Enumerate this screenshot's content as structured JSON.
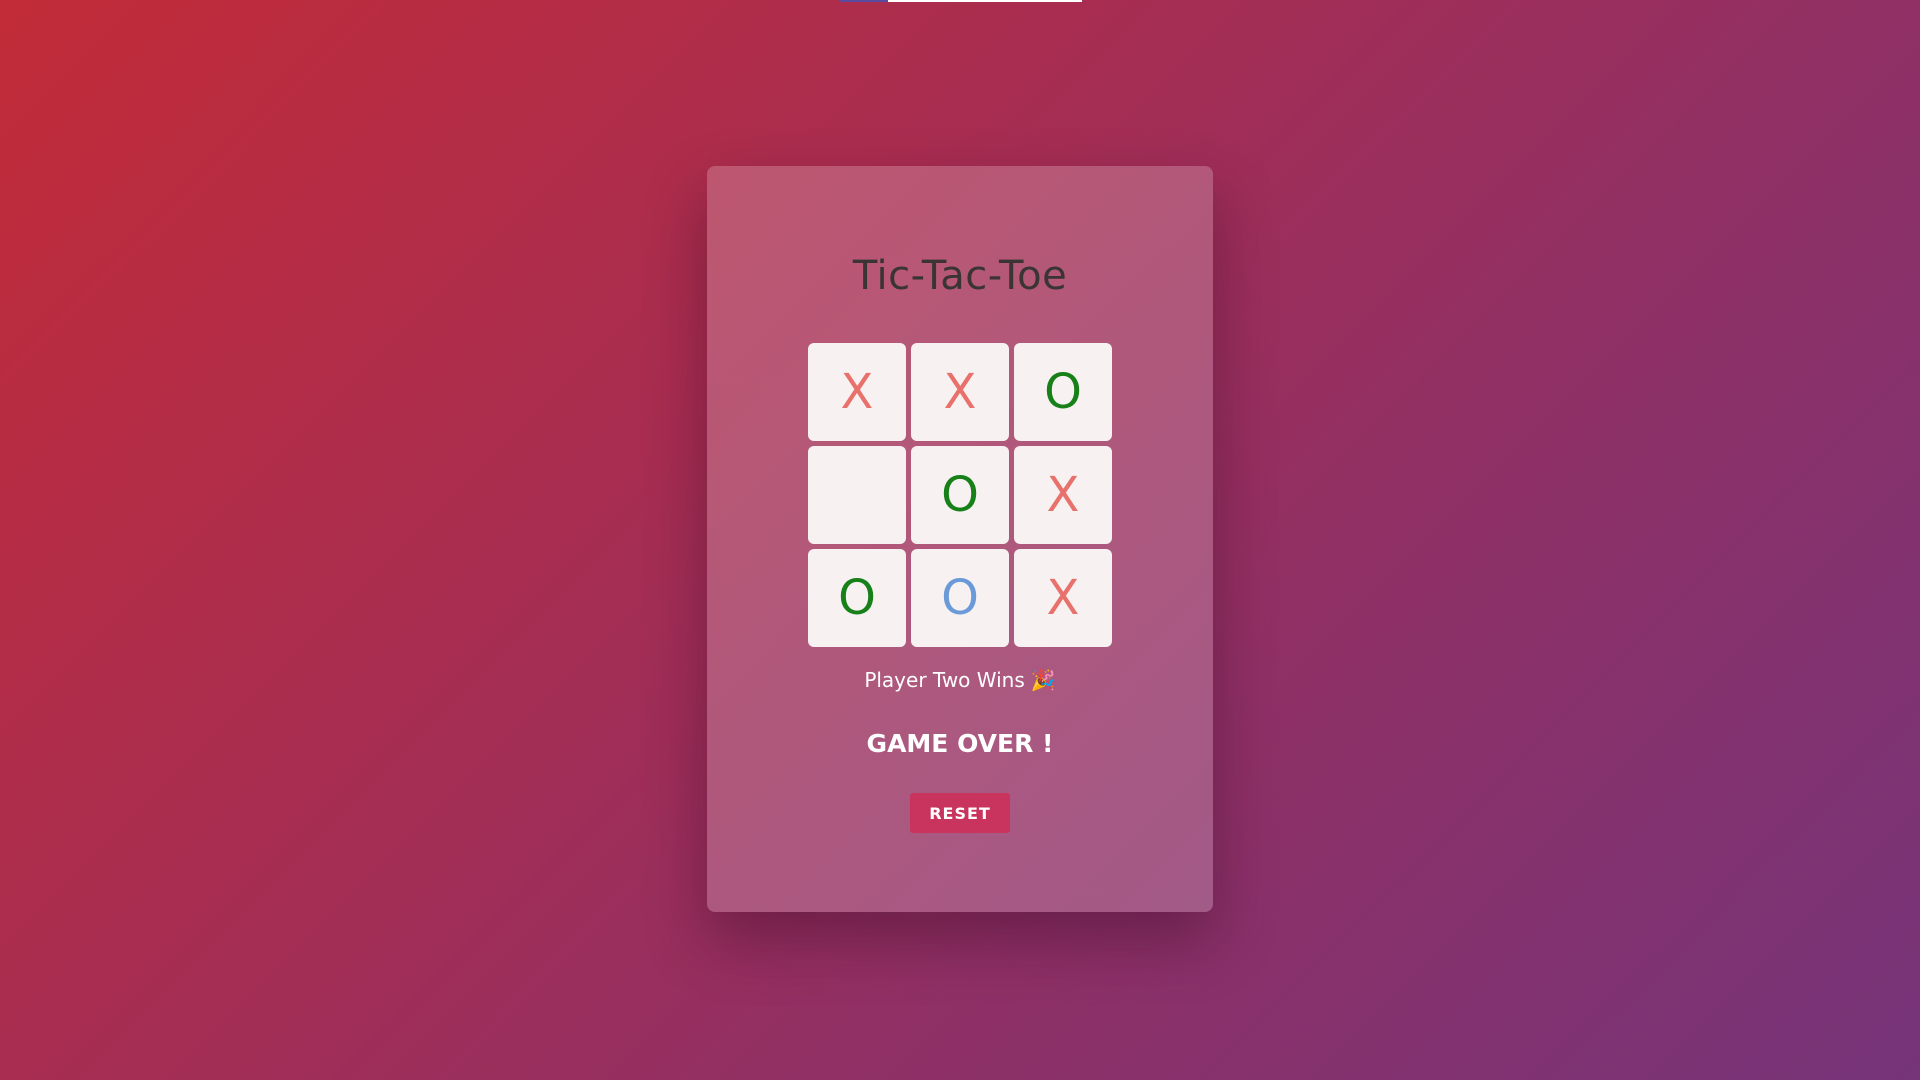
{
  "game": {
    "title": "Tic-Tac-Toe",
    "board": [
      {
        "mark": "X",
        "style": "x"
      },
      {
        "mark": "X",
        "style": "x"
      },
      {
        "mark": "O",
        "style": "o"
      },
      {
        "mark": "",
        "style": "empty"
      },
      {
        "mark": "O",
        "style": "o"
      },
      {
        "mark": "X",
        "style": "x"
      },
      {
        "mark": "O",
        "style": "o"
      },
      {
        "mark": "O",
        "style": "o-highlight"
      },
      {
        "mark": "X",
        "style": "x"
      }
    ],
    "status_text": "Player Two Wins",
    "status_emoji": "🎉",
    "game_over_text": "GAME OVER !",
    "reset_label": "RESET"
  },
  "colors": {
    "x_mark": "#e8716b",
    "o_mark": "#188018",
    "o_highlight": "#6a9ad8",
    "reset_button": "#c8345e"
  }
}
